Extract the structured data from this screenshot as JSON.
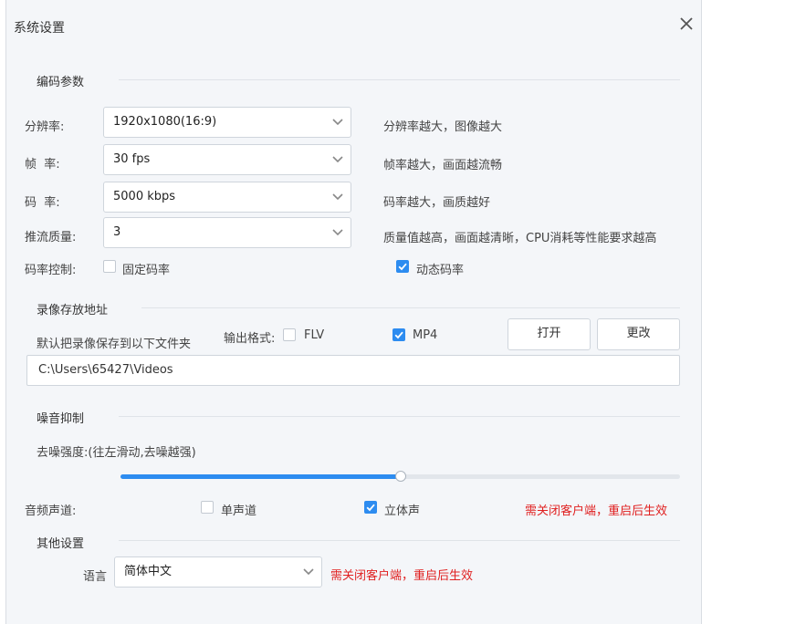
{
  "window": {
    "title": "系统设置",
    "close_icon": "close-icon"
  },
  "encoding": {
    "section_title": "编码参数",
    "resolution": {
      "label": "分辨率:",
      "value": "1920x1080(16:9)",
      "hint": "分辨率越大，图像越大"
    },
    "framerate": {
      "label": "帧  率:",
      "value": "30 fps",
      "hint": "帧率越大，画面越流畅"
    },
    "bitrate": {
      "label": "码  率:",
      "value": "5000 kbps",
      "hint": "码率越大，画质越好"
    },
    "quality": {
      "label": "推流质量:",
      "value": "3",
      "hint": "质量值越高，画面越清晰，CPU消耗等性能要求越高"
    },
    "rate_control": {
      "label": "码率控制:",
      "fixed_label": "固定码率",
      "fixed_checked": false,
      "dynamic_label": "动态码率",
      "dynamic_checked": true
    }
  },
  "recording": {
    "section_title": "录像存放地址",
    "desc": "默认把录像保存到以下文件夹",
    "format_label": "输出格式:",
    "flv_label": "FLV",
    "flv_checked": false,
    "mp4_label": "MP4",
    "mp4_checked": true,
    "open_button": "打开",
    "change_button": "更改",
    "path": "C:\\Users\\65427\\Videos"
  },
  "noise": {
    "section_title": "噪音抑制",
    "strength_label": "去噪强度:(往左滑动,去噪越强)",
    "strength_fraction": 0.5
  },
  "audio": {
    "channel_label": "音频声道:",
    "mono_label": "单声道",
    "mono_checked": false,
    "stereo_label": "立体声",
    "stereo_checked": true,
    "notice": "需关闭客户端，重启后生效"
  },
  "other": {
    "section_title": "其他设置",
    "language_label": "语言",
    "language_value": "简体中文",
    "notice": "需关闭客户端，重启后生效"
  },
  "colors": {
    "accent": "#2d8cf0",
    "warning": "#e02020"
  }
}
